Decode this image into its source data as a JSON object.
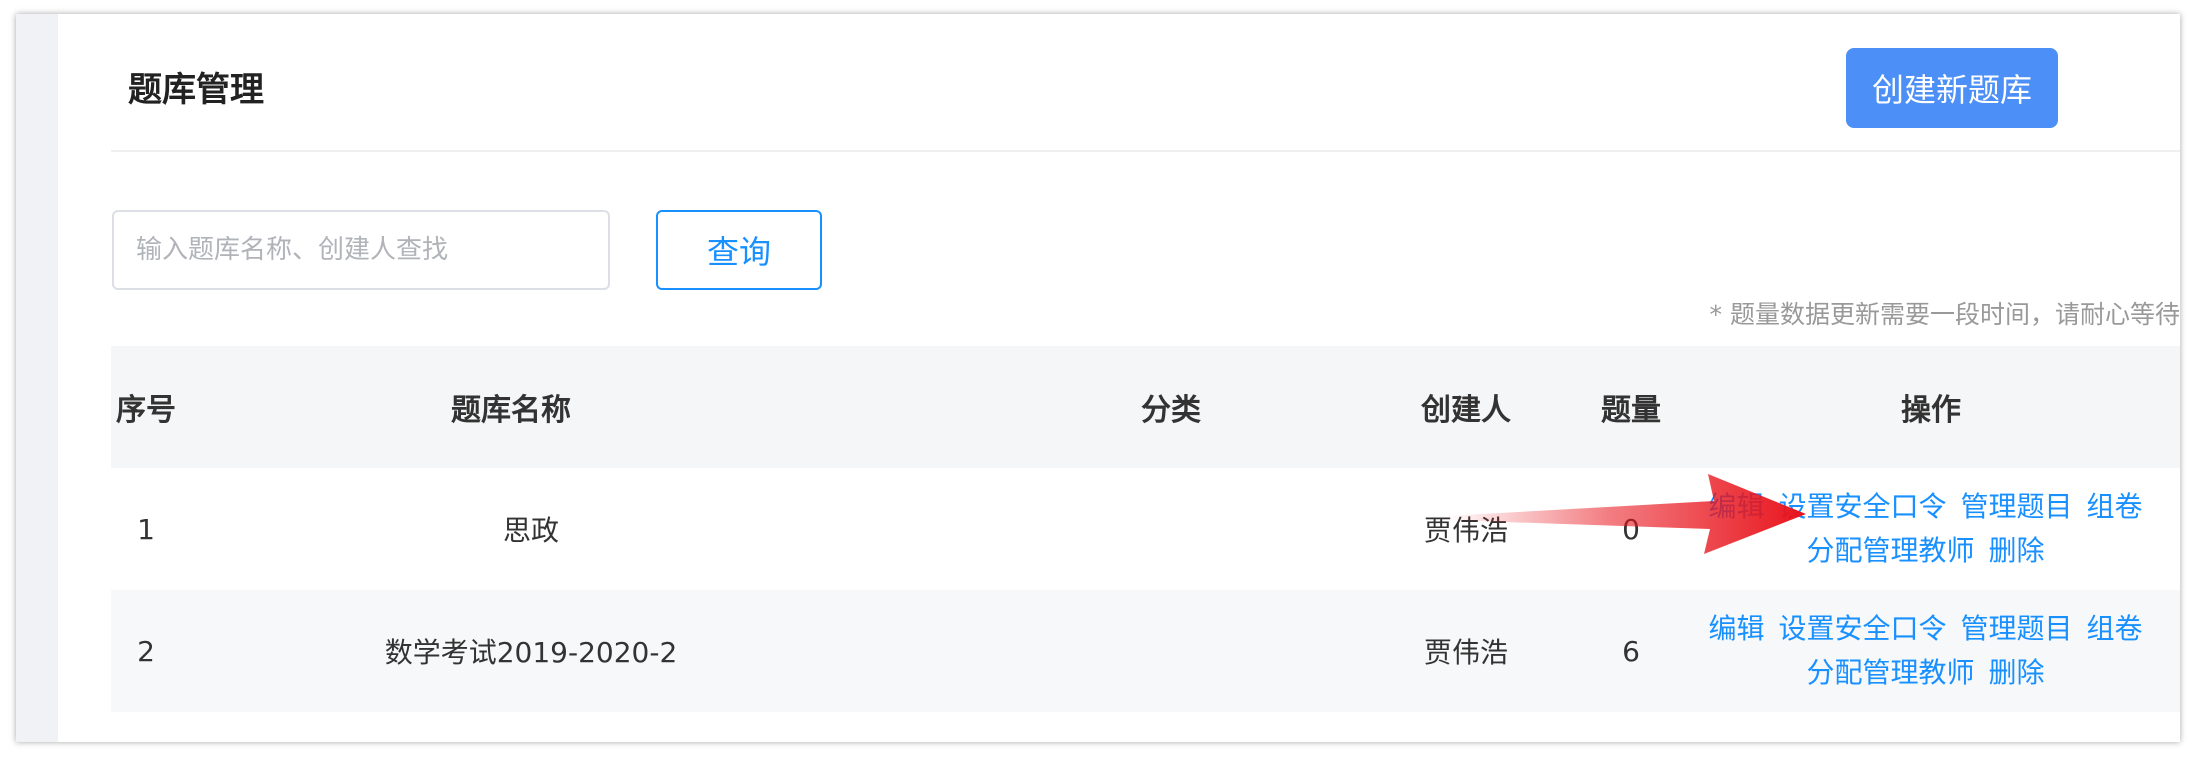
{
  "header": {
    "title": "题库管理",
    "create_button_label": "创建新题库"
  },
  "search": {
    "placeholder": "输入题库名称、创建人查找",
    "value": "",
    "query_button_label": "查询"
  },
  "note": "* 题量数据更新需要一段时间，请耐心等待",
  "table": {
    "columns": [
      "序号",
      "题库名称",
      "分类",
      "创建人",
      "题量",
      "操作"
    ],
    "rows": [
      {
        "index": "1",
        "name": "思政",
        "category": "",
        "creator": "贾伟浩",
        "count": "0",
        "actions": [
          "编辑",
          "设置安全口令",
          "管理题目",
          "组卷",
          "分配管理教师",
          "删除"
        ]
      },
      {
        "index": "2",
        "name": "数学考试2019-2020-2",
        "category": "",
        "creator": "贾伟浩",
        "count": "6",
        "actions": [
          "编辑",
          "设置安全口令",
          "管理题目",
          "组卷",
          "分配管理教师",
          "删除"
        ]
      }
    ]
  },
  "colors": {
    "primary_button": "#4b8ff7",
    "link": "#1890ff",
    "annotation_arrow": "#e8141c",
    "header_row_bg": "#f5f6f7"
  },
  "annotation": {
    "icon": "red-arrow-icon"
  }
}
